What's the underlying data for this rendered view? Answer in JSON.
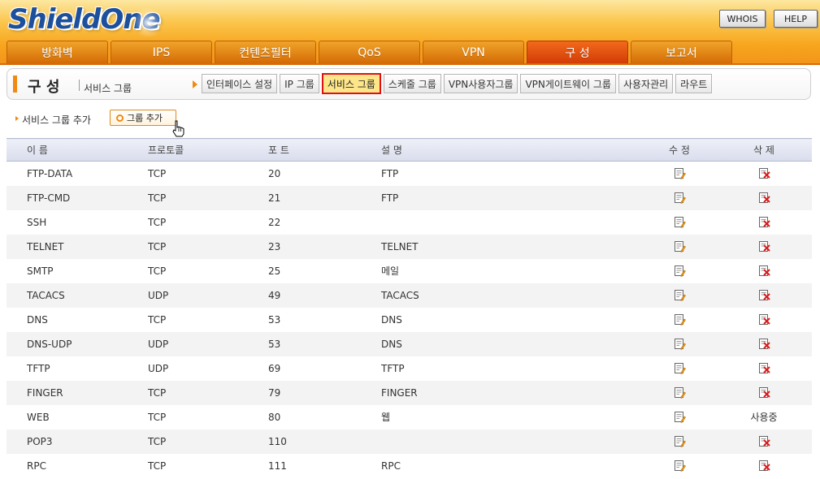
{
  "app": {
    "logo": "ShieldOne",
    "top_buttons": [
      "WHOIS",
      "HELP"
    ]
  },
  "nav": {
    "tabs": [
      "방화벽",
      "IPS",
      "컨텐츠필터",
      "QoS",
      "VPN",
      "구 성",
      "보고서"
    ],
    "active": "구 성"
  },
  "subheader": {
    "title": "구 성",
    "subtitle": "서비스 그룹",
    "items": [
      "인터페이스 설정",
      "IP 그룹",
      "서비스 그룹",
      "스케줄 그룹",
      "VPN사용자그룹",
      "VPN게이트웨이 그룹",
      "사용자관리",
      "라우트"
    ],
    "active": "서비스 그룹"
  },
  "toolbar": {
    "label": "서비스 그룹 추가",
    "add_button": "그룹 추가"
  },
  "table": {
    "columns": [
      "이 름",
      "프로토콜",
      "포 트",
      "설 명",
      "수 정",
      "삭 제"
    ],
    "rows": [
      {
        "name": "FTP-DATA",
        "protocol": "TCP",
        "port": "20",
        "desc": "FTP",
        "delete": ""
      },
      {
        "name": "FTP-CMD",
        "protocol": "TCP",
        "port": "21",
        "desc": "FTP",
        "delete": ""
      },
      {
        "name": "SSH",
        "protocol": "TCP",
        "port": "22",
        "desc": "",
        "delete": ""
      },
      {
        "name": "TELNET",
        "protocol": "TCP",
        "port": "23",
        "desc": "TELNET",
        "delete": ""
      },
      {
        "name": "SMTP",
        "protocol": "TCP",
        "port": "25",
        "desc": "메일",
        "delete": ""
      },
      {
        "name": "TACACS",
        "protocol": "UDP",
        "port": "49",
        "desc": "TACACS",
        "delete": ""
      },
      {
        "name": "DNS",
        "protocol": "TCP",
        "port": "53",
        "desc": "DNS",
        "delete": ""
      },
      {
        "name": "DNS-UDP",
        "protocol": "UDP",
        "port": "53",
        "desc": "DNS",
        "delete": ""
      },
      {
        "name": "TFTP",
        "protocol": "UDP",
        "port": "69",
        "desc": "TFTP",
        "delete": ""
      },
      {
        "name": "FINGER",
        "protocol": "TCP",
        "port": "79",
        "desc": "FINGER",
        "delete": ""
      },
      {
        "name": "WEB",
        "protocol": "TCP",
        "port": "80",
        "desc": "웹",
        "delete": "사용중"
      },
      {
        "name": "POP3",
        "protocol": "TCP",
        "port": "110",
        "desc": "",
        "delete": ""
      },
      {
        "name": "RPC",
        "protocol": "TCP",
        "port": "111",
        "desc": "RPC",
        "delete": ""
      }
    ]
  },
  "colors": {
    "accent": "#f08a12",
    "nav_active": "#d23c06",
    "highlight_border": "#e01010",
    "highlight_fill": "#fde68a"
  },
  "icons": {
    "edit": "edit-document-icon",
    "delete": "delete-x-icon",
    "cursor": "hand-pointer-icon"
  }
}
